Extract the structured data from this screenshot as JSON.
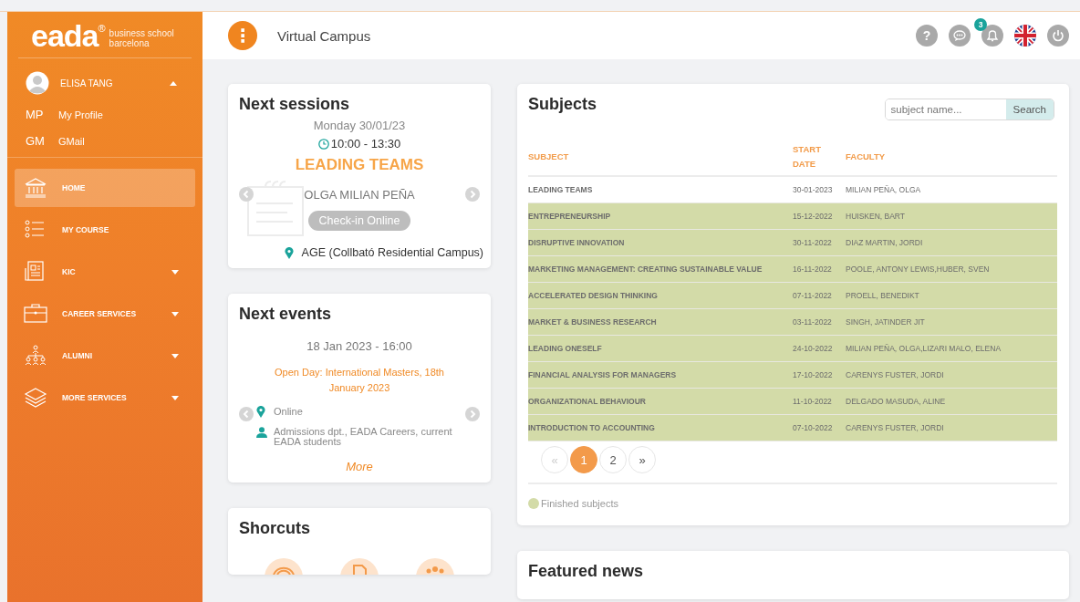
{
  "sidebar": {
    "logo": {
      "mark": "eada",
      "reg": "®",
      "tagline": "business school barcelona"
    },
    "user": {
      "name": "ELISA TANG",
      "expanded": true,
      "links": [
        {
          "abbr": "MP",
          "label": "My Profile"
        },
        {
          "abbr": "GM",
          "label": "GMail"
        }
      ]
    },
    "items": [
      {
        "label": "HOME",
        "kind": "bank",
        "selected": true,
        "expandable": false
      },
      {
        "label": "MY COURSE",
        "kind": "list",
        "selected": false,
        "expandable": false
      },
      {
        "label": "KIC",
        "kind": "document",
        "selected": false,
        "expandable": true
      },
      {
        "label": "CAREER SERVICES",
        "kind": "briefcase",
        "selected": false,
        "expandable": true
      },
      {
        "label": "ALUMNI",
        "kind": "people",
        "selected": false,
        "expandable": true
      },
      {
        "label": "MORE SERVICES",
        "kind": "layers",
        "selected": false,
        "expandable": true
      }
    ]
  },
  "topbar": {
    "menu_icon": "⋮",
    "title": "Virtual Campus",
    "help_icon": "?",
    "notifications_count": "3"
  },
  "next_sessions": {
    "title": "Next sessions",
    "date": "Monday 30/01/23",
    "time": "10:00 - 13:30",
    "subject": "LEADING TEAMS",
    "teacher": "OLGA MILIAN PEÑA",
    "button": "Check-in Online",
    "location": "AGE (Collbató Residential Campus)"
  },
  "next_events": {
    "title": "Next events",
    "datetime": "18 Jan 2023 - 16:00",
    "event": "Open Day: International Masters, 18th January 2023",
    "location": "Online",
    "audience": "Admissions dpt., EADA Careers, current EADA students",
    "more": "More"
  },
  "shortcuts": {
    "title": "Shorcuts"
  },
  "subjects": {
    "title": "Subjects",
    "search": {
      "placeholder": "subject name...",
      "button": "Search"
    },
    "columns": [
      "SUBJECT",
      "START DATE",
      "FACULTY"
    ],
    "rows": [
      {
        "subject": "LEADING TEAMS",
        "start_date": "30-01-2023",
        "faculty": "MILIAN PEÑA, OLGA",
        "finished": false
      },
      {
        "subject": "ENTREPRENEURSHIP",
        "start_date": "15-12-2022",
        "faculty": "HUISKEN, BART",
        "finished": true
      },
      {
        "subject": "DISRUPTIVE INNOVATION",
        "start_date": "30-11-2022",
        "faculty": "DIAZ MARTIN, JORDI",
        "finished": true
      },
      {
        "subject": "MARKETING MANAGEMENT: CREATING SUSTAINABLE VALUE",
        "start_date": "16-11-2022",
        "faculty": "POOLE, ANTONY LEWIS,HUBER, SVEN",
        "finished": true
      },
      {
        "subject": "ACCELERATED DESIGN THINKING",
        "start_date": "07-11-2022",
        "faculty": "PROELL, BENEDIKT",
        "finished": true
      },
      {
        "subject": "MARKET & BUSINESS RESEARCH",
        "start_date": "03-11-2022",
        "faculty": "SINGH, JATINDER JIT",
        "finished": true
      },
      {
        "subject": "LEADING ONESELF",
        "start_date": "24-10-2022",
        "faculty": "MILIAN PEÑA, OLGA,LIZARI MALO, ELENA",
        "finished": true
      },
      {
        "subject": "FINANCIAL ANALYSIS FOR MANAGERS",
        "start_date": "17-10-2022",
        "faculty": "CARENYS FUSTER, JORDI",
        "finished": true
      },
      {
        "subject": "ORGANIZATIONAL BEHAVIOUR",
        "start_date": "11-10-2022",
        "faculty": "DELGADO MASUDA, ALINE",
        "finished": true
      },
      {
        "subject": "INTRODUCTION TO ACCOUNTING",
        "start_date": "07-10-2022",
        "faculty": "CARENYS FUSTER, JORDI",
        "finished": true
      }
    ],
    "pagination": [
      {
        "label": "«",
        "selected": false,
        "disabled": true
      },
      {
        "label": "1",
        "selected": true,
        "disabled": false
      },
      {
        "label": "2",
        "selected": false,
        "disabled": false
      },
      {
        "label": "»",
        "selected": false,
        "disabled": false
      }
    ],
    "legend": {
      "label": "Finished subjects",
      "color": "#d3dba8"
    }
  },
  "featured_news": {
    "title": "Featured news"
  }
}
